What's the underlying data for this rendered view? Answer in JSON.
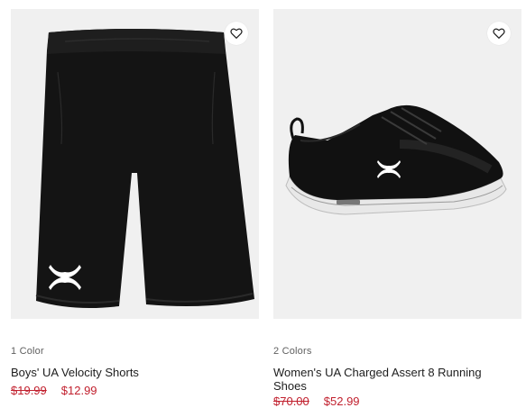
{
  "products": [
    {
      "colors": "1 Color",
      "name": "Boys' UA Velocity Shorts",
      "old_price": "$19.99",
      "price": "$12.99",
      "image": "black-athletic-shorts",
      "favorite_icon": "heart-outline-icon"
    },
    {
      "colors": "2 Colors",
      "name": "Women's UA Charged Assert 8 Running Shoes",
      "old_price": "$70.00",
      "price": "$52.99",
      "image": "black-running-shoe",
      "favorite_icon": "heart-outline-icon"
    }
  ],
  "colors": {
    "sale_red": "#c1202e",
    "image_bg": "#f0f0f0",
    "text": "#1d1d1d",
    "muted": "#5f5f5f"
  }
}
